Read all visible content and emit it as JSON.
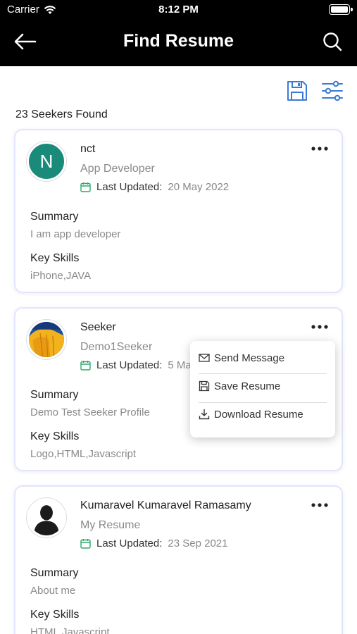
{
  "status": {
    "carrier": "Carrier",
    "time": "8:12 PM"
  },
  "header": {
    "title": "Find Resume"
  },
  "results": {
    "count_text": "23 Seekers Found"
  },
  "labels": {
    "last_updated": "Last Updated:",
    "summary": "Summary",
    "key_skills": "Key Skills"
  },
  "cards": [
    {
      "initial": "N",
      "name": "nct",
      "role": "App Developer",
      "updated": "20 May 2022",
      "summary": "I am app developer",
      "skills": "iPhone,JAVA"
    },
    {
      "name": "Seeker",
      "role": "Demo1Seeker",
      "updated": "5 Ma",
      "summary": "Demo Test Seeker Profile",
      "skills": "Logo,HTML,Javascript"
    },
    {
      "name": "Kumaravel Kumaravel Ramasamy",
      "role": "My Resume",
      "updated": "23 Sep 2021",
      "summary": "About me",
      "skills": "HTML,Javascript,"
    }
  ],
  "menu": {
    "items": [
      "Send Message",
      "Save Resume",
      "Download Resume"
    ]
  },
  "colors": {
    "accent": "#3a7bd5",
    "calendar": "#2ea86b",
    "avatar_bg": "#1a8a7a"
  }
}
